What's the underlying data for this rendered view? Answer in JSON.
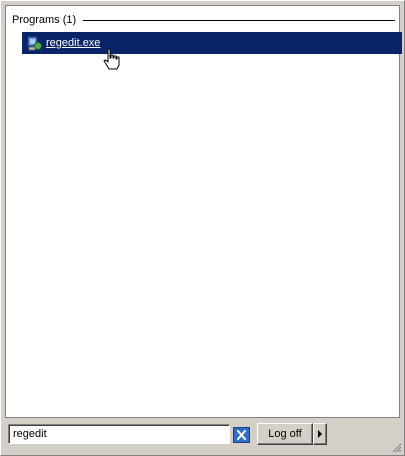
{
  "results": {
    "group_title": "Programs (1)",
    "items": [
      {
        "label": "regedit.exe",
        "icon": "regedit-icon"
      }
    ]
  },
  "search": {
    "value": "regedit",
    "clear_icon": "clear-search-icon"
  },
  "footer": {
    "logoff_label": "Log off",
    "more_icon": "arrow-right-icon"
  },
  "colors": {
    "selection": "#0a246a",
    "panel": "#ffffff",
    "chrome": "#d4d0c8"
  }
}
